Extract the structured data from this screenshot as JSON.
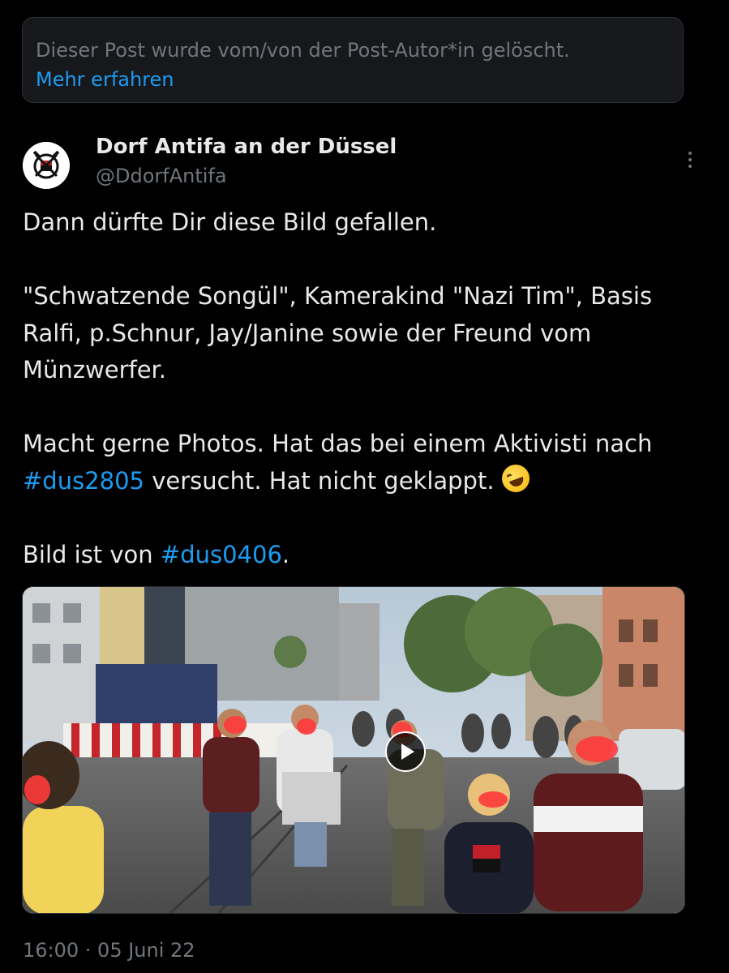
{
  "deleted_notice": {
    "text": "Dieser Post wurde vom/von der Post-Autor*in gelöscht.",
    "link": "Mehr erfahren"
  },
  "author": {
    "display_name": "Dorf Antifa an der Düssel",
    "handle": "@DdorfAntifa",
    "avatar_icon": "antifa-logo-icon"
  },
  "more_icon": "more-options-icon",
  "tweet": {
    "line1": "Dann dürfte Dir diese Bild gefallen.",
    "para2": "\"Schwatzende Songül\", Kamerakind \"Nazi Tim\", Basis Ralfi, p.Schnur, Jay/Janine sowie der Freund vom Münzwerfer.",
    "para3_prefix": "Macht gerne Photos. Hat das bei einem Aktivisti nach ",
    "para3_hashtag": "#dus2805",
    "para3_suffix": " versucht. Hat nicht geklappt. ",
    "para3_emoji": "rolling-on-the-floor-laughing-emoji",
    "para4_prefix": "Bild ist von ",
    "para4_hashtag": "#dus0406",
    "para4_suffix": "."
  },
  "media": {
    "type": "video",
    "play_icon": "play-icon"
  },
  "timestamp": "16:00 · 05 Juni 22",
  "colors": {
    "background": "#000000",
    "text": "#e7e9ea",
    "secondary": "#71767b",
    "link": "#1d9bf0"
  }
}
